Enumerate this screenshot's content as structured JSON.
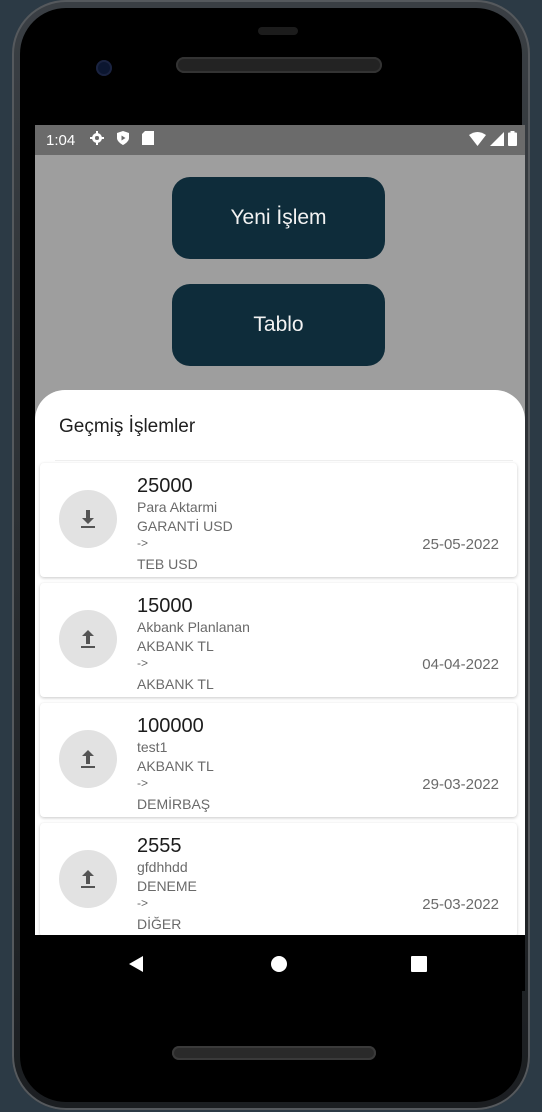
{
  "status_bar": {
    "time": "1:04"
  },
  "main": {
    "new_transaction_label": "Yeni İşlem",
    "table_label": "Tablo"
  },
  "history": {
    "title": "Geçmiş İşlemler",
    "items": [
      {
        "amount": "25000",
        "description": "Para Aktarmi",
        "from": "GARANTİ USD",
        "arrow": "->",
        "to": "TEB USD",
        "date": "25-05-2022",
        "icon": "download-icon"
      },
      {
        "amount": "15000",
        "description": "Akbank Planlanan",
        "from": "AKBANK TL",
        "arrow": "->",
        "to": "AKBANK TL",
        "date": "04-04-2022",
        "icon": "upload-icon"
      },
      {
        "amount": "100000",
        "description": "test1",
        "from": "AKBANK TL",
        "arrow": "->",
        "to": "DEMİRBAŞ",
        "date": "29-03-2022",
        "icon": "upload-icon"
      },
      {
        "amount": "2555",
        "description": "gfdhhdd",
        "from": "DENEME",
        "arrow": "->",
        "to": "DİĞER",
        "date": "25-03-2022",
        "icon": "upload-icon"
      }
    ]
  },
  "colors": {
    "primary_button": "#0e2c3a",
    "screen_background": "#9e9e9e",
    "status_bar": "#6b6b6b"
  }
}
